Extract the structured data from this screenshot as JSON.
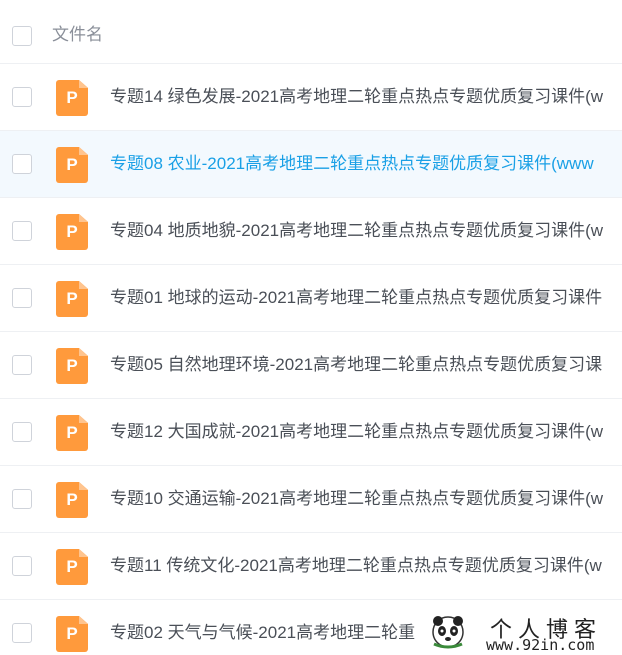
{
  "header": {
    "column_label": "文件名"
  },
  "files": [
    {
      "name": "专题14 绿色发展-2021高考地理二轮重点热点专题优质复习课件(w",
      "type_letter": "P"
    },
    {
      "name": "专题08 农业-2021高考地理二轮重点热点专题优质复习课件(www",
      "type_letter": "P"
    },
    {
      "name": "专题04 地质地貌-2021高考地理二轮重点热点专题优质复习课件(w",
      "type_letter": "P"
    },
    {
      "name": "专题01 地球的运动-2021高考地理二轮重点热点专题优质复习课件",
      "type_letter": "P"
    },
    {
      "name": "专题05 自然地理环境-2021高考地理二轮重点热点专题优质复习课",
      "type_letter": "P"
    },
    {
      "name": "专题12 大国成就-2021高考地理二轮重点热点专题优质复习课件(w",
      "type_letter": "P"
    },
    {
      "name": "专题10 交通运输-2021高考地理二轮重点热点专题优质复习课件(w",
      "type_letter": "P"
    },
    {
      "name": "专题11 传统文化-2021高考地理二轮重点热点专题优质复习课件(w",
      "type_letter": "P"
    },
    {
      "name": "专题02 天气与气候-2021高考地理二轮重",
      "type_letter": "P"
    }
  ],
  "watermark": {
    "title": "个人博客",
    "url": "www.92in.com"
  },
  "colors": {
    "icon": "#ff9a3c",
    "active_text": "#1aa0e6",
    "active_row_bg": "#f3f9fe"
  }
}
